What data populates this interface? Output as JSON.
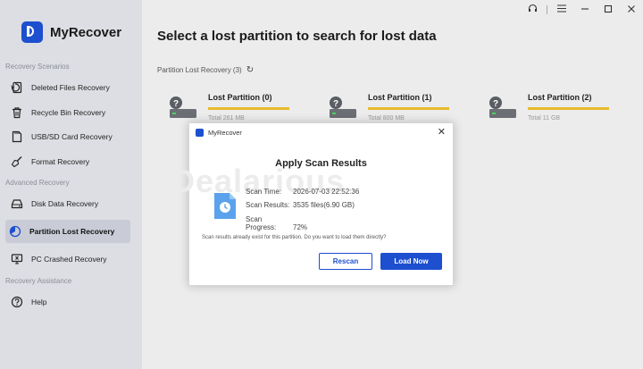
{
  "app": {
    "name": "MyRecover"
  },
  "window": {
    "support_icon": "headset-icon",
    "menu_icon": "hamburger-icon"
  },
  "sidebar": {
    "sections": [
      {
        "label": "Recovery Scenarios"
      },
      {
        "label": "Advanced Recovery"
      },
      {
        "label": "Recovery Assistance"
      }
    ],
    "items": [
      {
        "label": "Deleted Files Recovery",
        "icon": "restore-file-icon"
      },
      {
        "label": "Recycle Bin Recovery",
        "icon": "trash-icon"
      },
      {
        "label": "USB/SD Card Recovery",
        "icon": "sd-card-icon"
      },
      {
        "label": "Format Recovery",
        "icon": "broom-icon"
      },
      {
        "label": "Disk Data Recovery",
        "icon": "disk-icon"
      },
      {
        "label": "Partition Lost Recovery",
        "icon": "partition-icon",
        "active": true
      },
      {
        "label": "PC Crashed Recovery",
        "icon": "pc-crash-icon"
      },
      {
        "label": "Help",
        "icon": "help-icon"
      }
    ]
  },
  "main": {
    "title": "Select a lost partition to search for lost data",
    "subheading": "Partition Lost Recovery (3)",
    "partitions": [
      {
        "name": "Lost Partition (0)",
        "total": "Total 261 MB"
      },
      {
        "name": "Lost Partition (1)",
        "total": "Total 800 MB"
      },
      {
        "name": "Lost Partition (2)",
        "total": "Total 11 GB"
      }
    ]
  },
  "dialog": {
    "app_name": "MyRecover",
    "title": "Apply Scan Results",
    "watermark": "Dealarious",
    "scan_time_label": "Scan Time:",
    "scan_time": "2026-07-03 22:52:36",
    "scan_results_label": "Scan Results:",
    "scan_results": "3535 files(6.90 GB)",
    "scan_progress_label": "Scan Progress:",
    "scan_progress": "72%",
    "message": "Scan results already exist for this partition. Do you want to load them directly?",
    "rescan_label": "Rescan",
    "load_label": "Load Now"
  },
  "colors": {
    "accent": "#1d4fcf",
    "bar": "#e7bb2b",
    "sidebar_bg": "#dcdee3"
  }
}
